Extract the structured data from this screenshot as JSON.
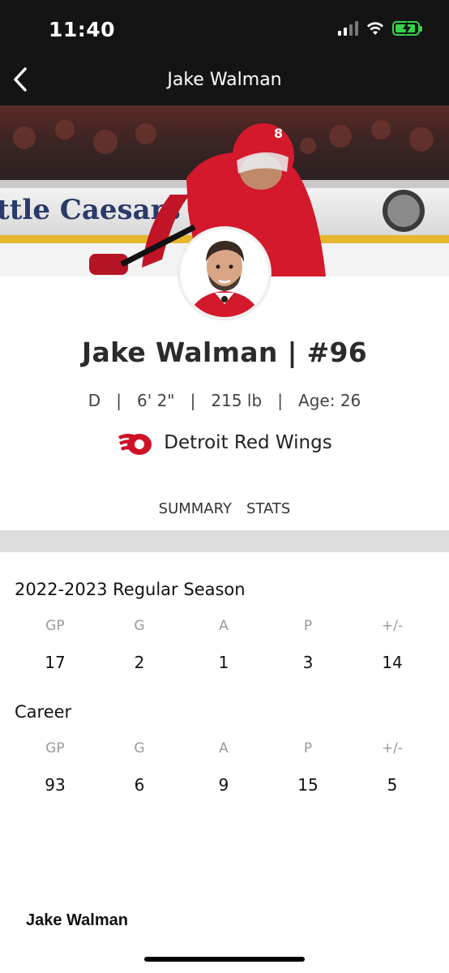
{
  "status_bar": {
    "time": "11:40",
    "icons": [
      "signal-icon",
      "wifi-icon",
      "battery-charging-icon"
    ]
  },
  "nav": {
    "title": "Jake Walman",
    "back_icon": "chevron-left-icon"
  },
  "hero": {
    "banner_text": "ttle Caesars"
  },
  "player": {
    "name_number": "Jake Walman | #96",
    "meta": "D   |   6' 2\"   |   215 lb   |   Age: 26",
    "team": "Detroit Red Wings",
    "jersey_number": "8"
  },
  "tabs": [
    "SUMMARY",
    "STATS"
  ],
  "season": {
    "title": "2022-2023 Regular Season",
    "headers": [
      "GP",
      "G",
      "A",
      "P",
      "+/-"
    ],
    "values": [
      "17",
      "2",
      "1",
      "3",
      "14"
    ]
  },
  "career": {
    "title": "Career",
    "headers": [
      "GP",
      "G",
      "A",
      "P",
      "+/-"
    ],
    "values": [
      "93",
      "6",
      "9",
      "15",
      "5"
    ]
  },
  "footer": {
    "name": "Jake Walman"
  },
  "colors": {
    "team_red": "#ce1126",
    "nav_bg": "#141414",
    "battery_green": "#37d34c",
    "divider": "#dcdcdc"
  }
}
